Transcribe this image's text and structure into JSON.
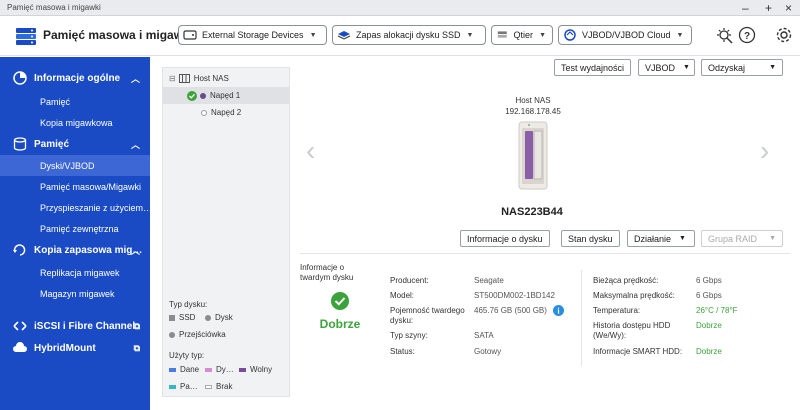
{
  "window": {
    "title": "Pamięć masowa i migawki",
    "min": "–",
    "max": "+",
    "close": "×"
  },
  "toolbar": {
    "app_title": "Pamięć masowa i migawki",
    "external": "External Storage Devices",
    "ssd_reserve": "Zapas alokacji dysku SSD",
    "qtier": "Qtier",
    "vjbod": "VJBOD/VJBOD Cloud"
  },
  "sidebar": {
    "general": "Informacje ogólne",
    "general_items": [
      "Pamięć",
      "Kopia migawkowa"
    ],
    "storage": "Pamięć",
    "storage_items": [
      "Dyski/VJBOD",
      "Pamięć masowa/Migawki",
      "Przyspieszanie z użyciem…",
      "Pamięć zewnętrzna"
    ],
    "backup": "Kopia zapasowa mig…",
    "backup_items": [
      "Replikacja migawek",
      "Magazyn migawek"
    ],
    "iscsi": "iSCSI i Fibre Channel",
    "hybrid": "HybridMount"
  },
  "tree": {
    "root": "Host NAS",
    "disks": [
      "Napęd 1",
      "Napęd 2"
    ]
  },
  "legend": {
    "disk_type": "Typ dysku:",
    "types": [
      "SSD",
      "Dysk",
      "Przejściówka"
    ],
    "used_type": "Użyty typ:",
    "used": [
      "Dane",
      "Dy…",
      "Wolny",
      "Pa…",
      "Brak"
    ]
  },
  "actions": {
    "test": "Test wydajności",
    "vjbod": "VJBOD",
    "recover": "Odzyskaj"
  },
  "device": {
    "name": "Host NAS",
    "ip": "192.168.178.45",
    "model": "NAS223B44"
  },
  "disk_buttons": {
    "info": "Informacje o dysku",
    "status": "Stan dysku",
    "action": "Działanie",
    "raid": "Grupa RAID"
  },
  "disk_info": {
    "section": "Informacje o twardym dysku",
    "health": "Dobrze",
    "left": [
      {
        "label": "Producent:",
        "value": "Seagate"
      },
      {
        "label": "Model:",
        "value": "ST500DM002-1BD142"
      },
      {
        "label": "Pojemność twardego dysku:",
        "value": "465.76 GB (500 GB)"
      },
      {
        "label": "Typ szyny:",
        "value": "SATA"
      },
      {
        "label": "Status:",
        "value": "Gotowy"
      }
    ],
    "right": [
      {
        "label": "Bieżąca prędkość:",
        "value": "6 Gbps"
      },
      {
        "label": "Maksymalna prędkość:",
        "value": "6 Gbps"
      },
      {
        "label": "Temperatura:",
        "value": "26°C / 78°F"
      },
      {
        "label": "Historia dostępu HDD (We/Wy):",
        "value": "Dobrze"
      },
      {
        "label": "Informacje SMART HDD:",
        "value": "Dobrze"
      }
    ]
  },
  "colors": {
    "sidebar": "#1a4bc4",
    "active": "#3c67d4",
    "good": "#3ba33b"
  }
}
